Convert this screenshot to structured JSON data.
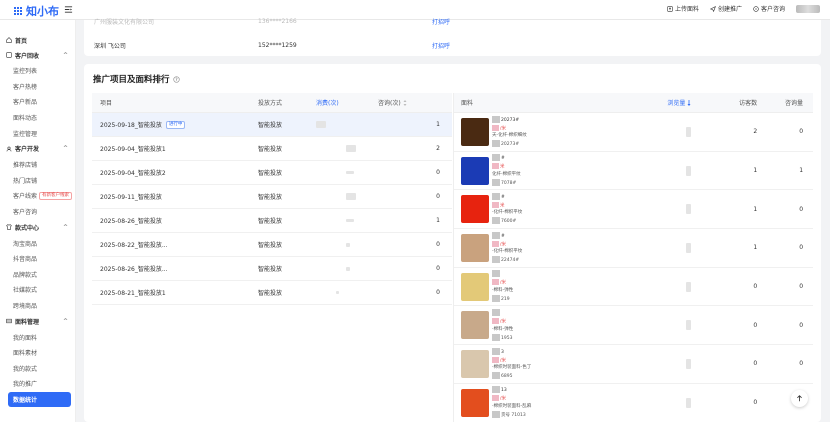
{
  "app": {
    "logo_text": "知小布"
  },
  "topbar": {
    "actions": [
      {
        "label": "上传面料",
        "icon": "upload-icon"
      },
      {
        "label": "创建推广",
        "icon": "send-icon"
      },
      {
        "label": "客户咨询",
        "icon": "chat-icon"
      }
    ]
  },
  "sidebar": {
    "home": "首页",
    "groups": [
      {
        "label": "客户回收",
        "items": [
          "监控列表",
          "客户热榜",
          "客户新品",
          "面料动态",
          "监控管理"
        ]
      },
      {
        "label": "客户开发",
        "items": [
          "推荐店铺",
          "热门店铺",
          "客户线索",
          "客户咨询"
        ]
      },
      {
        "label": "款式中心",
        "items": [
          "淘宝商品",
          "抖音商品",
          "品牌款式",
          "社媒款式",
          "跨境商品"
        ]
      },
      {
        "label": "面料管理",
        "items": [
          "我的面料",
          "面料素材",
          "我的款式",
          "我的推广",
          "数据统计"
        ]
      }
    ],
    "clue_tag": "有新客户线索"
  },
  "top_table": {
    "rows": [
      {
        "customer": "广州服装文化有限公司",
        "phone": "136****2166",
        "action": "打招呼"
      },
      {
        "customer": "深圳 飞公司",
        "phone": "152****1259",
        "action": "打招呼"
      }
    ]
  },
  "section": {
    "title": "推广项目及面料排行"
  },
  "project_table": {
    "headers": {
      "project": "项目",
      "method": "投放方式",
      "spend": "消费(次)",
      "inquiries": "咨询(次)"
    },
    "running_badge": "进行中",
    "rows": [
      {
        "name": "2025-09-18_智能投放",
        "method": "智能投放",
        "spend": "",
        "inquiries": "1",
        "running": true
      },
      {
        "name": "2025-09-04_智能投放1",
        "method": "智能投放",
        "spend": "",
        "inquiries": "2",
        "running": false
      },
      {
        "name": "2025-09-04_智能投放2",
        "method": "智能投放",
        "spend": "",
        "inquiries": "0",
        "running": false
      },
      {
        "name": "2025-09-11_智能投放",
        "method": "智能投放",
        "spend": "",
        "inquiries": "0",
        "running": false
      },
      {
        "name": "2025-08-26_智能投放",
        "method": "智能投放",
        "spend": "",
        "inquiries": "1",
        "running": false
      },
      {
        "name": "2025-08-22_智能投放...",
        "method": "智能投放",
        "spend": "",
        "inquiries": "0",
        "running": false
      },
      {
        "name": "2025-08-26_智能投放...",
        "method": "智能投放",
        "spend": "",
        "inquiries": "0",
        "running": false
      },
      {
        "name": "2025-08-21_智能投放1",
        "method": "智能投放",
        "spend": "",
        "inquiries": "0",
        "running": false
      }
    ]
  },
  "fabric_table": {
    "headers": {
      "fabric": "面料",
      "views": "浏览量",
      "visitors": "访客数",
      "inquiries": "咨询量"
    },
    "rows": [
      {
        "code": "20273#",
        "price": "/米",
        "desc": "天-化纤-棉织细纹",
        "id": "20273#",
        "visitors": "2",
        "inquiries": "0",
        "color": "#4a2a12"
      },
      {
        "code": "#",
        "price": "米",
        "desc": "化纤-棉织平纹",
        "id": "7078#",
        "visitors": "1",
        "inquiries": "1",
        "color": "#1b3bb5"
      },
      {
        "code": "#",
        "price": "米",
        "desc": "-化纤-棉织平纹",
        "id": "7600#",
        "visitors": "1",
        "inquiries": "0",
        "color": "#e7230f"
      },
      {
        "code": "#",
        "price": "/米",
        "desc": "-化纤-棉织平纹",
        "id": "22474#",
        "visitors": "1",
        "inquiries": "0",
        "color": "#c9a27e"
      },
      {
        "code": "",
        "price": "/米",
        "desc": "-棉料-弹性",
        "id": "219",
        "visitors": "0",
        "inquiries": "0",
        "color": "#e3c978"
      },
      {
        "code": "",
        "price": "/米",
        "desc": "-棉料-弹性",
        "id": "1953",
        "visitors": "0",
        "inquiries": "0",
        "color": "#c8a98a"
      },
      {
        "code": "3",
        "price": "/米",
        "desc": "-棉织时装面料-色丁",
        "id": "6895",
        "visitors": "0",
        "inquiries": "0",
        "color": "#d9c7ad"
      },
      {
        "code": "13",
        "price": "/米",
        "desc": "-棉织时装面料-乱麻",
        "id": "货号 71013",
        "visitors": "0",
        "inquiries": "0",
        "color": "#e34e1e"
      }
    ]
  }
}
